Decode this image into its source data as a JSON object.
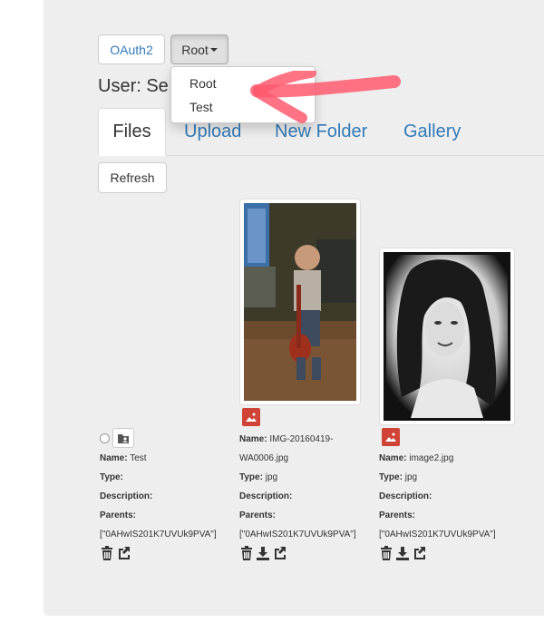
{
  "toolbar": {
    "oauth_label": "OAuth2",
    "root_label": "Root"
  },
  "user_label": "User: Se",
  "dropdown": {
    "items": [
      "Root",
      "Test"
    ]
  },
  "tabs": [
    "Files",
    "Upload",
    "New Folder",
    "Gallery"
  ],
  "refresh_label": "Refresh",
  "items": [
    {
      "name": "Test",
      "type": "",
      "description": "",
      "parents": "[\"0AHwIS201K7UVUk9PVA\"]"
    },
    {
      "name": "IMG-20160419-",
      "name2": "WA0006.jpg",
      "type": "jpg",
      "description": "",
      "parents": "[\"0AHwIS201K7UVUk9PVA\"]"
    },
    {
      "name": "image2.jpg",
      "type": "jpg",
      "description": "",
      "parents": "[\"0AHwIS201K7UVUk9PVA\"]"
    }
  ],
  "labels": {
    "name": "Name:",
    "type": "Type:",
    "description": "Description:",
    "parents": "Parents:"
  },
  "colors": {
    "link": "#337ab7",
    "accent_red": "#cf4436",
    "annotation": "#ff5a6e"
  }
}
